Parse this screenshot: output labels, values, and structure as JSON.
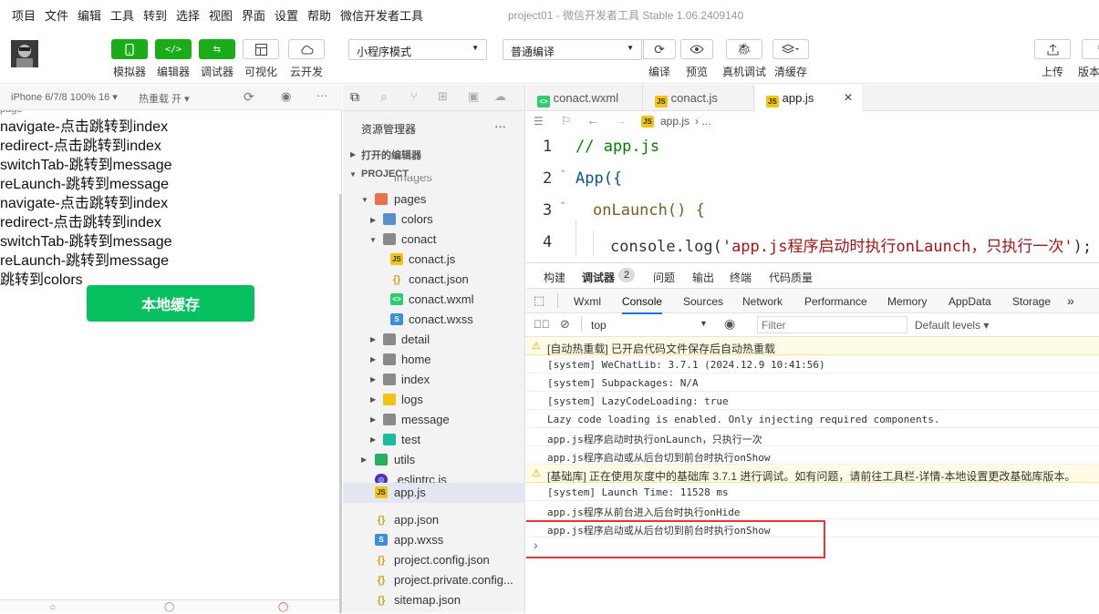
{
  "menubar": {
    "items": [
      "项目",
      "文件",
      "编辑",
      "工具",
      "转到",
      "选择",
      "视图",
      "界面",
      "设置",
      "帮助",
      "微信开发者工具"
    ],
    "window_title": "project01 - 微信开发者工具 Stable 1.06.2409140"
  },
  "toolbar": {
    "simulator": "模拟器",
    "editor": "编辑器",
    "debugger": "调试器",
    "visual": "可视化",
    "cloud": "云开发",
    "mode_select": "小程序模式",
    "compile_select": "普通编译",
    "compile": "编译",
    "preview": "预览",
    "device_debug": "真机调试",
    "clear_cache": "清缓存",
    "upload": "上传",
    "version": "版本"
  },
  "simulator": {
    "device": "iPhone 6/7/8 100% 16 ▾",
    "hot_reload": "热重载 开 ▾",
    "lines": [
      "navigate-点击跳转到index",
      "redirect-点击跳转到index",
      "switchTab-跳转到message",
      "reLaunch-跳转到message",
      "navigate-点击跳转到index",
      "redirect-点击跳转到index",
      "switchTab-跳转到message",
      "reLaunch-跳转到message",
      "跳转到colors"
    ],
    "save_button": "本地缓存"
  },
  "explorer": {
    "title": "资源管理器",
    "more": "···",
    "open_editors": "打开的编辑器",
    "project": "PROJECT",
    "partial_top": "images",
    "items": {
      "pages": "pages",
      "colors": "colors",
      "conact": "conact",
      "conact_js": "conact.js",
      "conact_json": "conact.json",
      "conact_wxml": "conact.wxml",
      "conact_wxss": "conact.wxss",
      "detail": "detail",
      "home": "home",
      "index": "index",
      "logs": "logs",
      "message": "message",
      "test": "test",
      "utils": "utils",
      "eslintrc": ".eslintrc.js",
      "app_js": "app.js",
      "app_json": "app.json",
      "app_wxss": "app.wxss",
      "project_config": "project.config.json",
      "project_private": "project.private.config...",
      "sitemap": "sitemap.json"
    }
  },
  "editor": {
    "tabs": [
      "conact.wxml",
      "conact.js",
      "app.js"
    ],
    "close": "✕",
    "breadcrumb_file": "app.js",
    "breadcrumb_more": "› ...",
    "lines": [
      {
        "n": "1",
        "text": "// app.js"
      },
      {
        "n": "2",
        "text": "App({"
      },
      {
        "n": "3",
        "text": "onLaunch() {"
      },
      {
        "n": "4",
        "pre": "console.log(",
        "str": "'app.js程序启动时执行onLaunch，只执行一次'",
        "post": ");"
      }
    ]
  },
  "devtools": {
    "top_tabs": [
      "构建",
      "调试器",
      "问题",
      "输出",
      "终端",
      "代码质量"
    ],
    "badge": "2",
    "sub_tabs": [
      "Wxml",
      "Console",
      "Sources",
      "Network",
      "Performance",
      "Memory",
      "AppData",
      "Storage"
    ],
    "more_tabs": "»",
    "context": "top",
    "filter_placeholder": "Filter",
    "levels": "Default levels ▾",
    "logs": [
      {
        "type": "warn",
        "text": "[自动热重载] 已开启代码文件保存后自动热重载"
      },
      {
        "type": "log",
        "text": "[system] WeChatLib: 3.7.1 (2024.12.9 10:41:56)"
      },
      {
        "type": "log",
        "text": "[system] Subpackages: N/A"
      },
      {
        "type": "log",
        "text": "[system] LazyCodeLoading: true"
      },
      {
        "type": "log",
        "text": "Lazy code loading is enabled. Only injecting required components."
      },
      {
        "type": "log",
        "text": "app.js程序启动时执行onLaunch，只执行一次"
      },
      {
        "type": "log",
        "text": "app.js程序启动或从后台切到前台时执行onShow"
      },
      {
        "type": "warn",
        "text": "[基础库] 正在使用灰度中的基础库 3.7.1 进行调试。如有问题，请前往工具栏-详情-本地设置更改基础库版本。"
      },
      {
        "type": "log",
        "text": "[system] Launch Time: 11528 ms"
      },
      {
        "type": "log",
        "text": "app.js程序从前台进入后台时执行onHide"
      },
      {
        "type": "log",
        "text": "app.js程序启动或从后台切到前台时执行onShow"
      }
    ],
    "prompt": "›"
  },
  "colors": {
    "green": "#1aad19",
    "save_green": "#07c160",
    "highlight_red": "#e53935",
    "warn_bg": "#fffbe5",
    "selected_file_bg": "#e4e6f1"
  }
}
